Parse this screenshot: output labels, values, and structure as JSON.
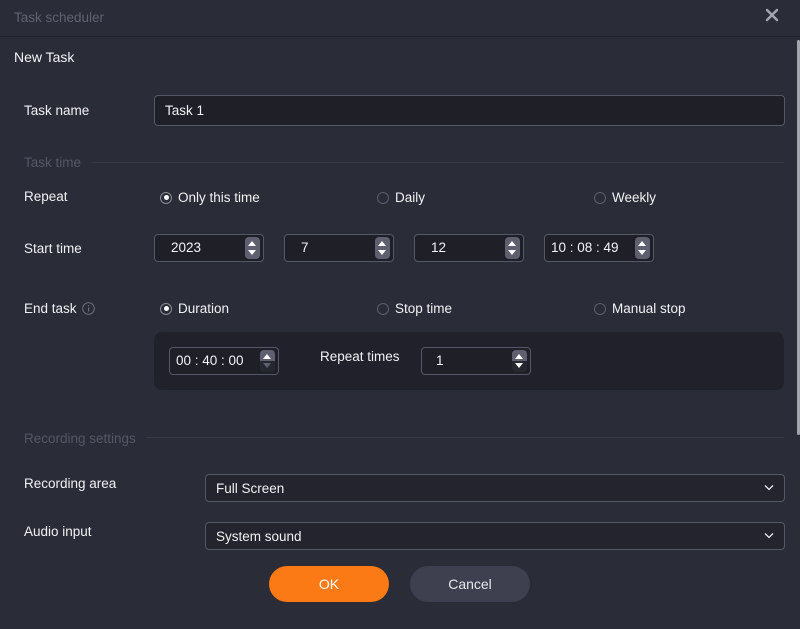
{
  "window": {
    "title": "Task scheduler",
    "close_icon": "close-icon"
  },
  "heading": "New Task",
  "task_name": {
    "label": "Task name",
    "value": "Task 1"
  },
  "task_time": {
    "section_title": "Task time",
    "repeat": {
      "label": "Repeat",
      "options": [
        {
          "label": "Only this time",
          "selected": true
        },
        {
          "label": "Daily",
          "selected": false
        },
        {
          "label": "Weekly",
          "selected": false
        }
      ]
    },
    "start_time": {
      "label": "Start time",
      "year": "2023",
      "month": "7",
      "day": "12",
      "time": "10 : 08 : 49"
    },
    "end_task": {
      "label": "End task",
      "info_icon": "info-icon",
      "options": [
        {
          "label": "Duration",
          "selected": true
        },
        {
          "label": "Stop time",
          "selected": false
        },
        {
          "label": "Manual stop",
          "selected": false
        }
      ],
      "duration": "00 : 40 : 00",
      "repeat_times_label": "Repeat times",
      "repeat_times": "1"
    }
  },
  "recording_settings": {
    "section_title": "Recording settings",
    "recording_area": {
      "label": "Recording area",
      "value": "Full Screen"
    },
    "audio_input": {
      "label": "Audio input",
      "value": "System sound"
    }
  },
  "buttons": {
    "ok": "OK",
    "cancel": "Cancel"
  },
  "colors": {
    "accent": "#fc7a16",
    "background": "#2a2c37",
    "secondary_button": "#3e4050"
  }
}
